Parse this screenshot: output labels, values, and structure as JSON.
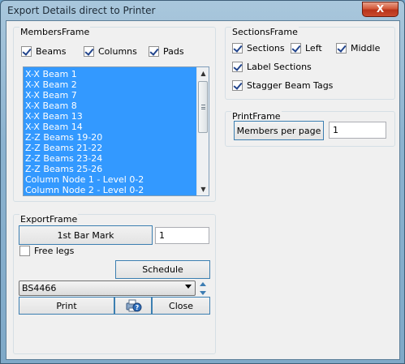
{
  "window": {
    "title": "Export Details direct to Printer",
    "close_label": "X"
  },
  "members_frame": {
    "title": "MembersFrame",
    "checkboxes": [
      {
        "label": "Beams",
        "checked": true
      },
      {
        "label": "Columns",
        "checked": true
      },
      {
        "label": "Pads",
        "checked": true
      }
    ],
    "list_items": [
      "X-X Beam 1",
      "X-X Beam 2",
      "X-X Beam 7",
      "X-X Beam 8",
      "X-X Beam 13",
      "X-X Beam 14",
      "Z-Z Beams 19-20",
      "Z-Z Beams 21-22",
      "Z-Z Beams 23-24",
      "Z-Z Beams 25-26",
      "Column Node 1 - Level 0-2",
      "Column Node 2 - Level 0-2"
    ],
    "selection_color": "#3399ff"
  },
  "sections_frame": {
    "title": "SectionsFrame",
    "checkboxes": [
      {
        "label": "Sections",
        "checked": true
      },
      {
        "label": "Left",
        "checked": true
      },
      {
        "label": "Middle",
        "checked": true
      },
      {
        "label": "Label Sections",
        "checked": true
      },
      {
        "label": "Stagger Beam Tags",
        "checked": true
      }
    ]
  },
  "print_frame": {
    "title": "PrintFrame",
    "members_per_page_label": "Members per page",
    "members_per_page_value": "1"
  },
  "export_frame": {
    "title": "ExportFrame",
    "first_bar_mark_label": "1st Bar Mark",
    "first_bar_mark_value": "1",
    "free_legs_label": "Free legs",
    "free_legs_checked": false,
    "schedule_label": "Schedule",
    "standard_selected": "BS4466",
    "print_label": "Print",
    "help_icon": "printer-help-icon",
    "close_label": "Close"
  }
}
